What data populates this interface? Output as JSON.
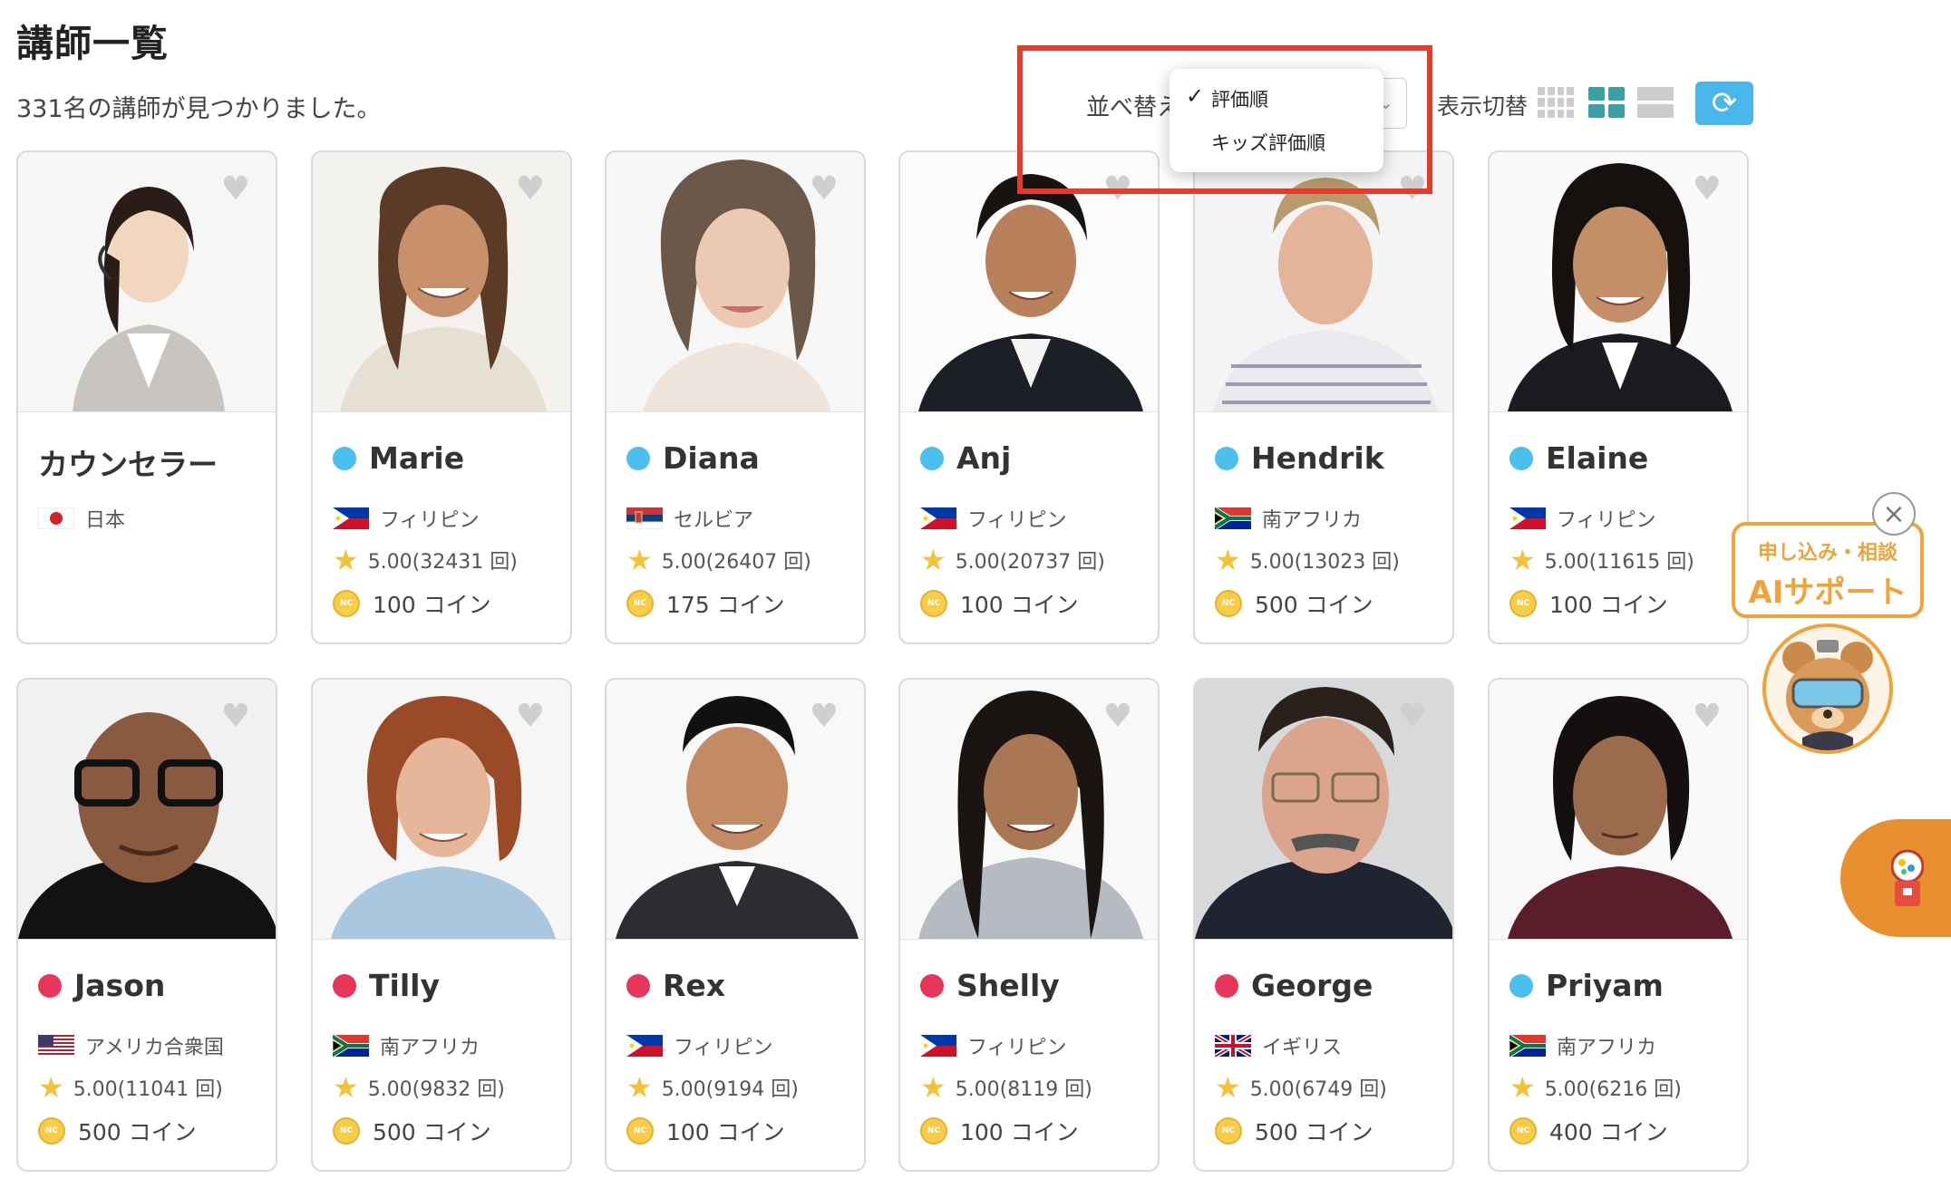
{
  "page": {
    "title": "講師一覧",
    "result_count": "331名の講師が見つかりました。"
  },
  "toolbar": {
    "sort_label": "並べ替え",
    "sort_options": [
      "評価順",
      "キッズ評価順"
    ],
    "sort_selected": "評価順",
    "view_label": "表示切替",
    "view_icons": [
      "grid-small-icon",
      "grid-large-icon",
      "list-view-icon"
    ],
    "refresh_icon": "refresh-icon",
    "accent_color": "#4ab7ea",
    "highlight_color": "#e53b2a"
  },
  "teachers": [
    {
      "name": "カウンセラー",
      "country": "日本",
      "rating": "",
      "coins": "",
      "status": "none"
    },
    {
      "name": "Marie",
      "country": "フィリピン",
      "rating": "5.00(32431 回)",
      "coins": "100 コイン",
      "status": "blue"
    },
    {
      "name": "Diana",
      "country": "セルビア",
      "rating": "5.00(26407 回)",
      "coins": "175 コイン",
      "status": "blue"
    },
    {
      "name": "Anj",
      "country": "フィリピン",
      "rating": "5.00(20737 回)",
      "coins": "100 コイン",
      "status": "blue"
    },
    {
      "name": "Hendrik",
      "country": "南アフリカ",
      "rating": "5.00(13023 回)",
      "coins": "500 コイン",
      "status": "blue"
    },
    {
      "name": "Elaine",
      "country": "フィリピン",
      "rating": "5.00(11615 回)",
      "coins": "100 コイン",
      "status": "blue"
    },
    {
      "name": "Jason",
      "country": "アメリカ合衆国",
      "rating": "5.00(11041 回)",
      "coins": "500 コイン",
      "status": "red"
    },
    {
      "name": "Tilly",
      "country": "南アフリカ",
      "rating": "5.00(9832 回)",
      "coins": "500 コイン",
      "status": "red"
    },
    {
      "name": "Rex",
      "country": "フィリピン",
      "rating": "5.00(9194 回)",
      "coins": "100 コイン",
      "status": "red"
    },
    {
      "name": "Shelly",
      "country": "フィリピン",
      "rating": "5.00(8119 回)",
      "coins": "100 コイン",
      "status": "red"
    },
    {
      "name": "George",
      "country": "イギリス",
      "rating": "5.00(6749 回)",
      "coins": "500 コイン",
      "status": "red"
    },
    {
      "name": "Priyam",
      "country": "南アフリカ",
      "rating": "5.00(6216 回)",
      "coins": "400 コイン",
      "status": "blue"
    }
  ],
  "coin_badge": "NC",
  "ai_support": {
    "line1": "申し込み・相談",
    "line2": "AIサポート"
  },
  "status_colors": {
    "blue": "#4bc0ef",
    "red": "#e8365a"
  }
}
